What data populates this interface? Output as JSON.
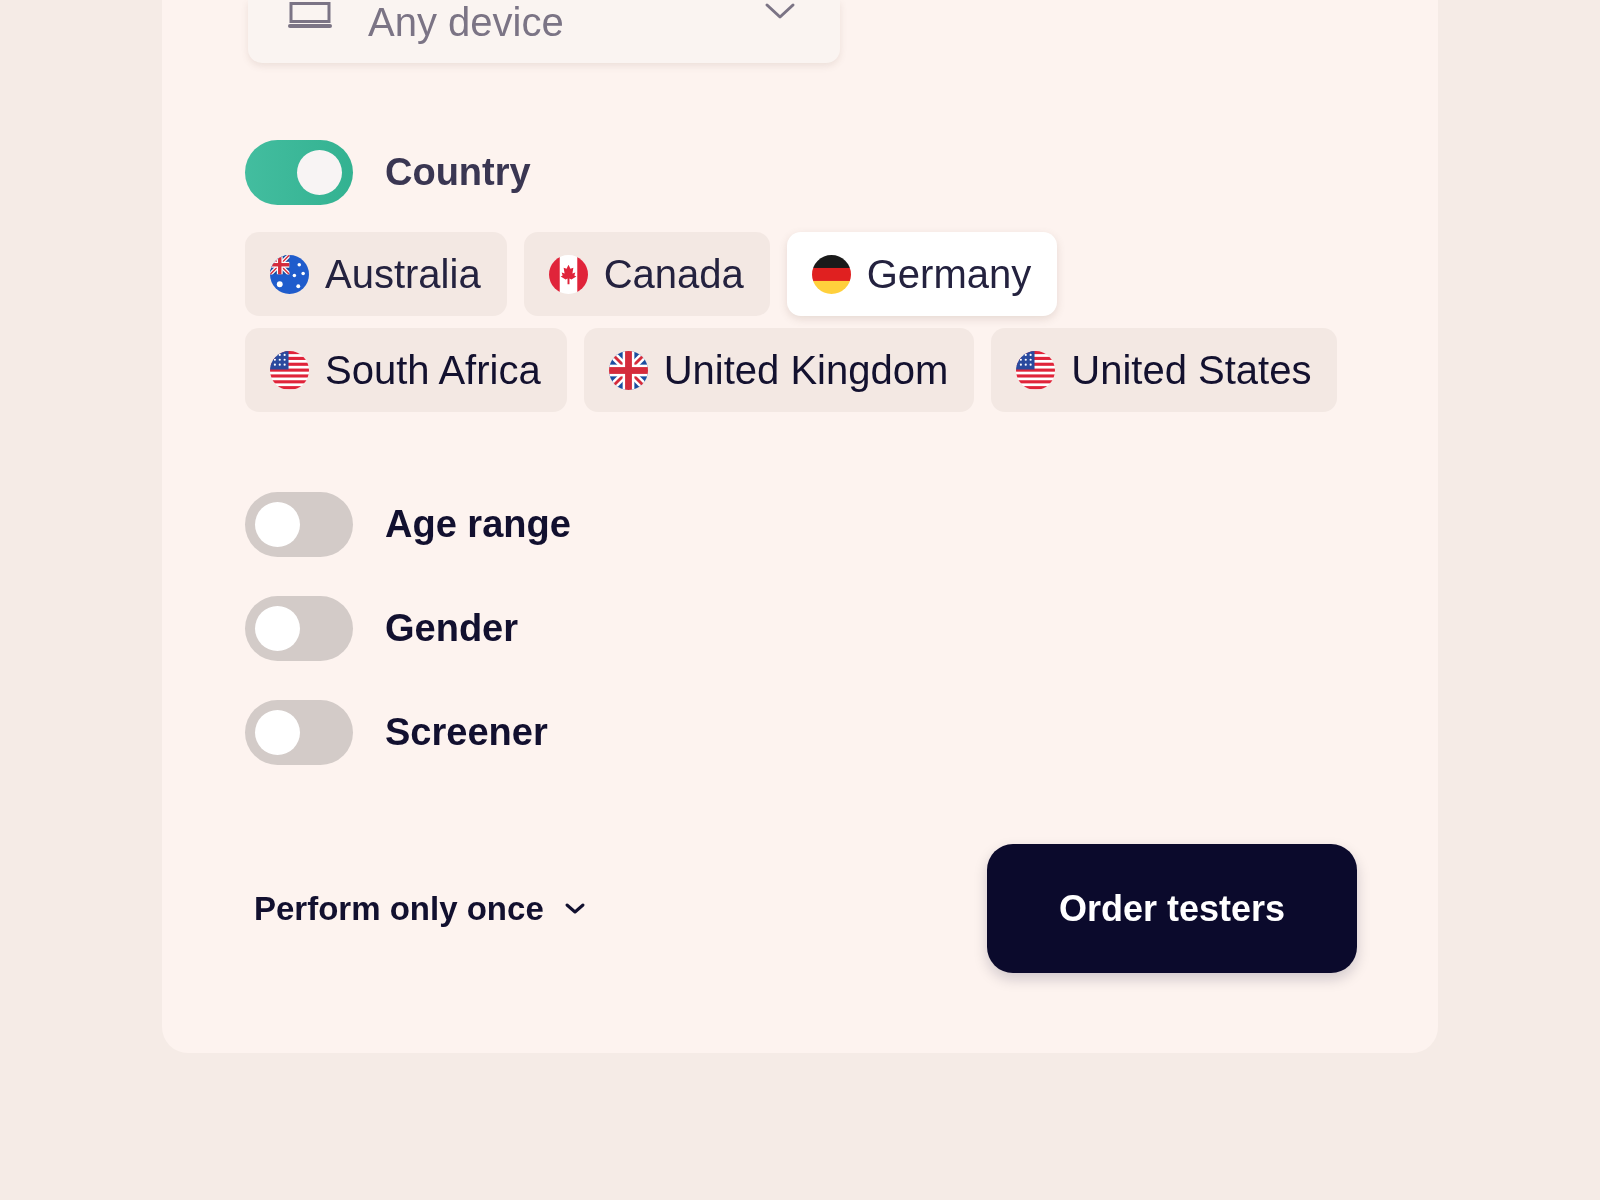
{
  "device_select": {
    "value": "Any device"
  },
  "country_filter": {
    "label": "Country",
    "on": true,
    "options": [
      {
        "name": "Australia",
        "kind": "australia",
        "selected": false
      },
      {
        "name": "Canada",
        "kind": "canada",
        "selected": false
      },
      {
        "name": "Germany",
        "kind": "germany",
        "selected": true
      },
      {
        "name": "South Africa",
        "kind": "usa",
        "selected": false
      },
      {
        "name": "United Kingdom",
        "kind": "uk",
        "selected": false
      },
      {
        "name": "United States",
        "kind": "usa",
        "selected": false
      }
    ]
  },
  "filters": [
    {
      "label": "Age range",
      "on": false
    },
    {
      "label": "Gender",
      "on": false
    },
    {
      "label": "Screener",
      "on": false
    }
  ],
  "footer": {
    "frequency": "Perform only once",
    "order_button": "Order testers"
  }
}
